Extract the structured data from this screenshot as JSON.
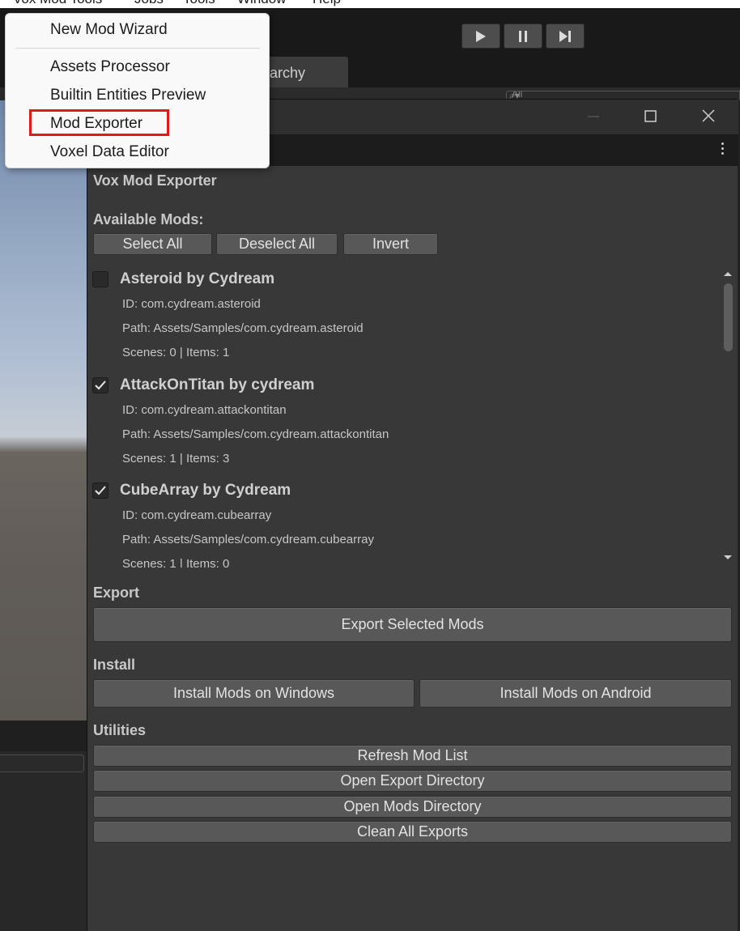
{
  "menubar": {
    "items": [
      "Vox Mod Tools",
      "Jobs",
      "Tools",
      "Window",
      "Help"
    ]
  },
  "toolbar": {
    "play_icon": "play-icon",
    "pause_icon": "pause-icon",
    "step_icon": "step-icon"
  },
  "tabs": {
    "hierarchy_label": "rarchy"
  },
  "search": {
    "placeholder": "All"
  },
  "dropdown": {
    "items": [
      "New Mod Wizard",
      "Assets Processor",
      "Builtin Entities Preview",
      "Mod Exporter",
      "Voxel Data Editor"
    ],
    "highlighted": "Mod Exporter",
    "highlight_color": "#e0191f"
  },
  "window": {
    "heading": "Vox Mod Exporter",
    "available_label": "Available Mods:",
    "select_all": "Select All",
    "deselect_all": "Deselect All",
    "invert": "Invert",
    "mods": [
      {
        "title": "Asteroid by Cydream",
        "checked": false,
        "id_line": "ID: com.cydream.asteroid",
        "path_line": "Path: Assets/Samples/com.cydream.asteroid",
        "stats_line": "Scenes: 0 | Items: 1"
      },
      {
        "title": "AttackOnTitan by cydream",
        "checked": true,
        "id_line": "ID: com.cydream.attackontitan",
        "path_line": "Path: Assets/Samples/com.cydream.attackontitan",
        "stats_line": "Scenes: 1 | Items: 3"
      },
      {
        "title": "CubeArray by Cydream",
        "checked": true,
        "id_line": "ID: com.cydream.cubearray",
        "path_line": "Path: Assets/Samples/com.cydream.cubearray",
        "stats_line": "Scenes: 1 | Items: 0"
      }
    ],
    "export_label": "Export",
    "export_selected": "Export Selected Mods",
    "install_label": "Install",
    "install_windows": "Install Mods on Windows",
    "install_android": "Install Mods on Android",
    "utilities_label": "Utilities",
    "refresh": "Refresh Mod List",
    "open_export_dir": "Open Export Directory",
    "open_mods_dir": "Open Mods Directory",
    "clean_exports": "Clean All Exports"
  }
}
